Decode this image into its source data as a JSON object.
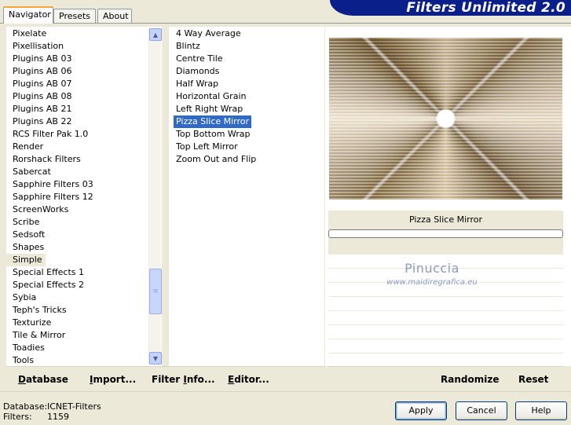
{
  "app": {
    "title": "Filters Unlimited 2.0"
  },
  "tabs": [
    {
      "label": "Navigator",
      "active": true
    },
    {
      "label": "Presets",
      "active": false
    },
    {
      "label": "About",
      "active": false
    }
  ],
  "categories": {
    "items": [
      "Pixelate",
      "Pixellisation",
      "Plugins AB 03",
      "Plugins AB 06",
      "Plugins AB 07",
      "Plugins AB 08",
      "Plugins AB 21",
      "Plugins AB 22",
      "RCS Filter Pak 1.0",
      "Render",
      "Rorshack Filters",
      "Sabercat",
      "Sapphire Filters 03",
      "Sapphire Filters 12",
      "ScreenWorks",
      "Scribe",
      "Sedsoft",
      "Shapes",
      "Simple",
      "Special Effects 1",
      "Special Effects 2",
      "Sybia",
      "Teph's Tricks",
      "Texturize",
      "Tile & Mirror",
      "Toadies",
      "Tools"
    ],
    "selected": "Simple"
  },
  "filters": {
    "items": [
      "4 Way Average",
      "Blintz",
      "Centre Tile",
      "Diamonds",
      "Half Wrap",
      "Horizontal Grain",
      "Left Right Wrap",
      "Pizza Slice Mirror",
      "Top Bottom Wrap",
      "Top Left Mirror",
      "Zoom Out and Flip"
    ],
    "selected": "Pizza Slice Mirror"
  },
  "preview": {
    "filter_name": "Pizza Slice Mirror",
    "watermark": "Pinuccia",
    "watermark_url": "www.maidiregrafica.eu"
  },
  "toolbar": {
    "database": {
      "first": "D",
      "rest": "atabase"
    },
    "import": {
      "first": "I",
      "rest": "mport..."
    },
    "filter_info": {
      "pre": "Filter ",
      "first": "I",
      "rest": "nfo..."
    },
    "editor": {
      "first": "E",
      "rest": "ditor..."
    },
    "randomize": "Randomize",
    "reset": "Reset"
  },
  "status": {
    "database_label": "Database:",
    "database_value": "ICNET-Filters",
    "filters_label": "Filters:",
    "filters_value": "1159"
  },
  "buttons": {
    "apply": "Apply",
    "cancel": "Cancel",
    "help": "Help"
  }
}
